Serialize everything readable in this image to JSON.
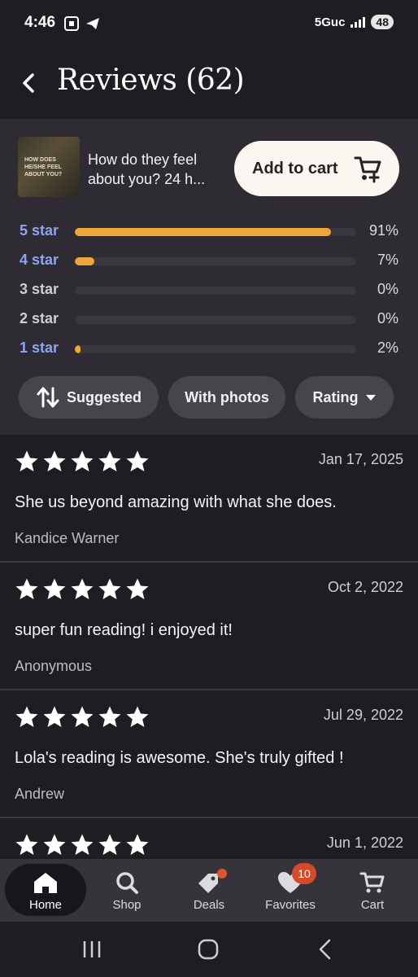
{
  "status_bar": {
    "time": "4:46",
    "network": "5Guc",
    "battery": "48"
  },
  "header": {
    "title": "Reviews (62)"
  },
  "product": {
    "thumb_text": "How does he/she feel about you?",
    "title": "How do they feel about you? 24 h...",
    "add_to_cart_label": "Add to cart"
  },
  "ratings": [
    {
      "label": "5 star",
      "percent_label": "91%",
      "fraction": 0.91
    },
    {
      "label": "4 star",
      "percent_label": "7%",
      "fraction": 0.07
    },
    {
      "label": "3 star",
      "percent_label": "0%",
      "fraction": 0.0
    },
    {
      "label": "2 star",
      "percent_label": "0%",
      "fraction": 0.0
    },
    {
      "label": "1 star",
      "percent_label": "2%",
      "fraction": 0.02
    }
  ],
  "filters": {
    "suggested": "Suggested",
    "with_photos": "With photos",
    "rating": "Rating"
  },
  "reviews": [
    {
      "stars": 5,
      "date": "Jan 17, 2025",
      "text": "She us beyond amazing with what she does.",
      "author": "Kandice Warner"
    },
    {
      "stars": 5,
      "date": "Oct 2, 2022",
      "text": "super fun reading! i enjoyed it!",
      "author": "Anonymous"
    },
    {
      "stars": 5,
      "date": "Jul 29, 2022",
      "text": "Lola's reading is awesome. She's truly gifted !",
      "author": "Andrew"
    },
    {
      "stars": 5,
      "date": "Jun 1, 2022",
      "text": "",
      "author": ""
    }
  ],
  "bottom_nav": {
    "home": "Home",
    "shop": "Shop",
    "deals": "Deals",
    "favorites": "Favorites",
    "favorites_count": "10",
    "cart": "Cart"
  },
  "colors": {
    "background": "#1f1d22",
    "panel": "#2e2c32",
    "bar_fill": "#f0a638",
    "link": "#8fa3f0",
    "badge": "#d64b27"
  }
}
